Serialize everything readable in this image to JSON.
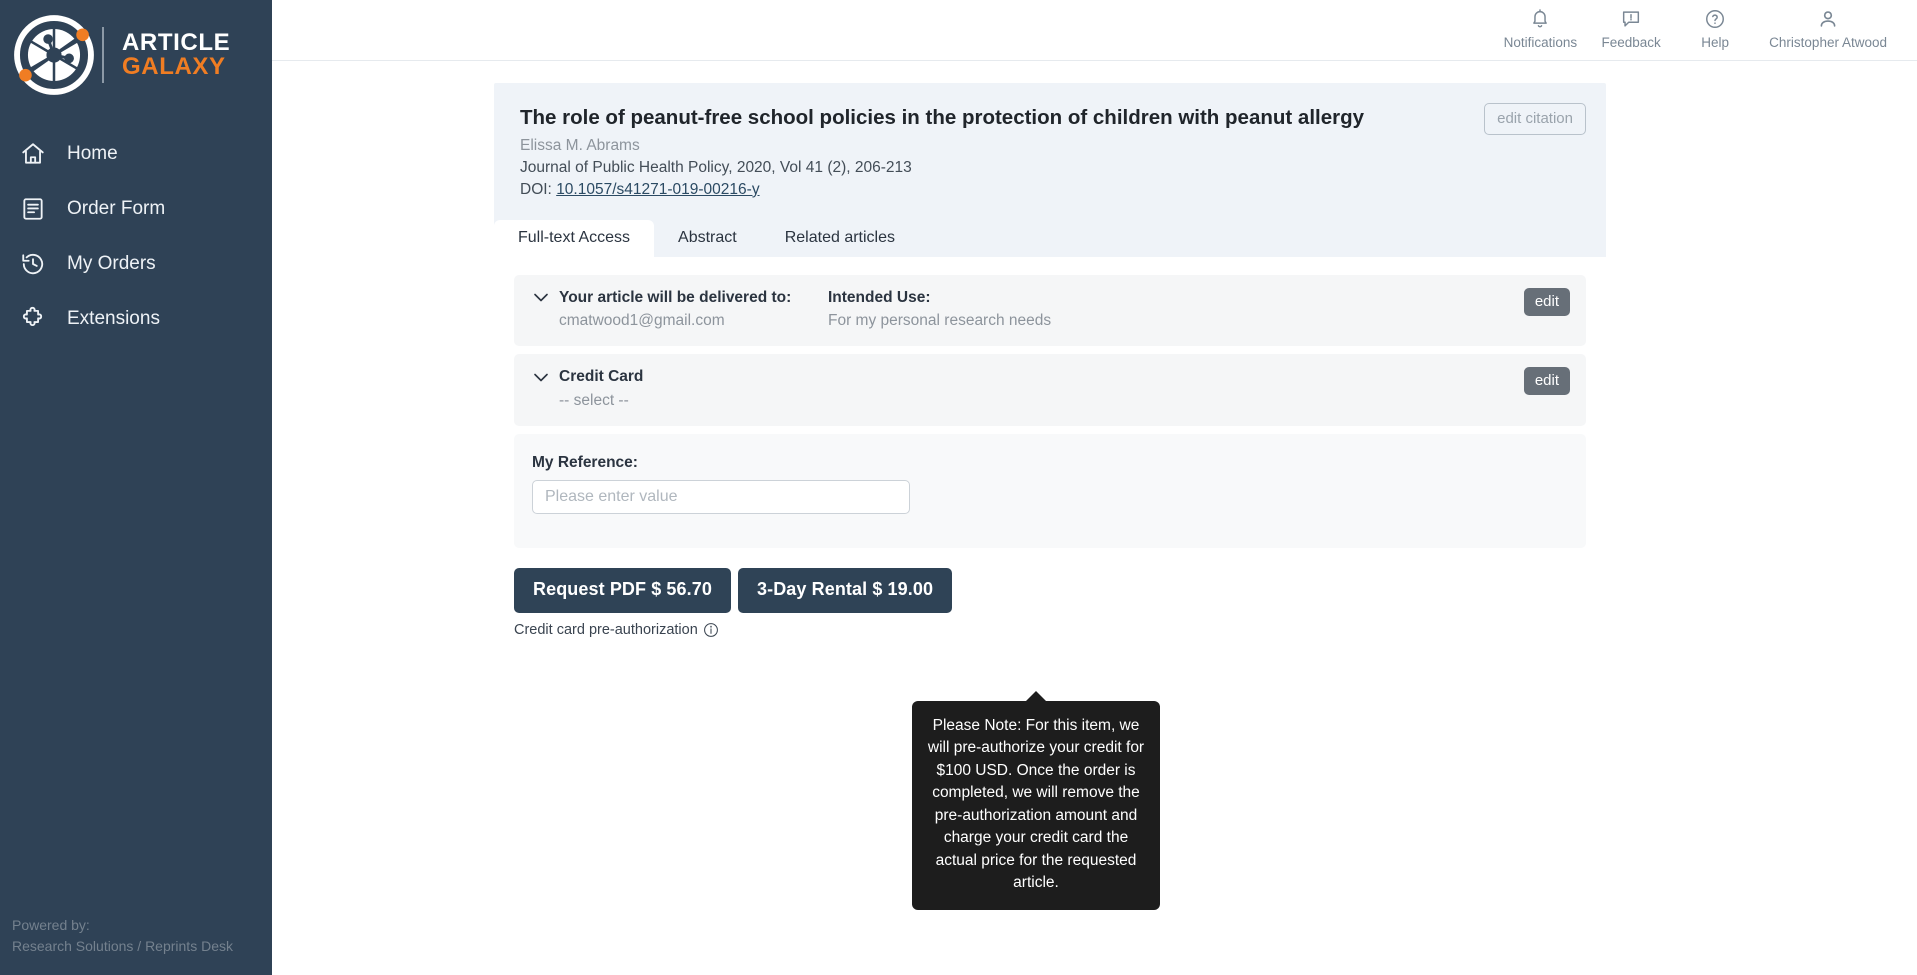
{
  "brand": {
    "logo_icon": "article-galaxy-logo-icon",
    "name_line1": "ARTICLE",
    "name_line2": "GALAXY",
    "accent_color": "#f07d23",
    "sidebar_color": "#2f4256"
  },
  "sidebar": {
    "items": [
      {
        "label": "Home",
        "icon": "home-icon"
      },
      {
        "label": "Order Form",
        "icon": "document-icon"
      },
      {
        "label": "My Orders",
        "icon": "history-clock-icon"
      },
      {
        "label": "Extensions",
        "icon": "puzzle-piece-icon"
      }
    ],
    "footer": {
      "line1": "Powered by:",
      "line2": "Research Solutions / Reprints Desk"
    }
  },
  "topbar": {
    "items": [
      {
        "label": "Notifications",
        "icon": "bell-icon"
      },
      {
        "label": "Feedback",
        "icon": "comment-alert-icon"
      },
      {
        "label": "Help",
        "icon": "question-circle-icon"
      },
      {
        "label": "Christopher Atwood",
        "icon": "user-account-icon"
      }
    ]
  },
  "article": {
    "title": "The role of peanut-free school policies in the protection of children with peanut allergy",
    "authors": "Elissa M. Abrams",
    "journal": "Journal of Public Health Policy, 2020, Vol 41 (2), 206-213",
    "doi_label": "DOI:",
    "doi_value": "10.1057/s41271-019-00216-y",
    "edit_citation_label": "edit citation"
  },
  "tabs": [
    {
      "label": "Full-text Access",
      "active": true
    },
    {
      "label": "Abstract",
      "active": false
    },
    {
      "label": "Related articles",
      "active": false
    }
  ],
  "delivery": {
    "label": "Your article will be delivered to:",
    "value": "cmatwood1@gmail.com",
    "intended_use_label": "Intended Use:",
    "intended_use_value": "For my personal research needs",
    "edit_label": "edit"
  },
  "payment": {
    "label": "Credit Card",
    "value": "-- select --",
    "edit_label": "edit"
  },
  "reference": {
    "label": "My Reference:",
    "placeholder": "Please enter value",
    "value": ""
  },
  "actions": {
    "request_pdf_label": "Request PDF $ 56.70",
    "rental_label": "3-Day Rental $ 19.00",
    "preauth_label": "Credit card pre-authorization",
    "info_icon": "info-circle-icon"
  },
  "tooltip": {
    "text": "Please Note: For this item, we will pre-authorize your credit for $100 USD. Once the order is completed, we will remove the pre-authorization amount and charge your credit card the actual price for the requested article."
  }
}
